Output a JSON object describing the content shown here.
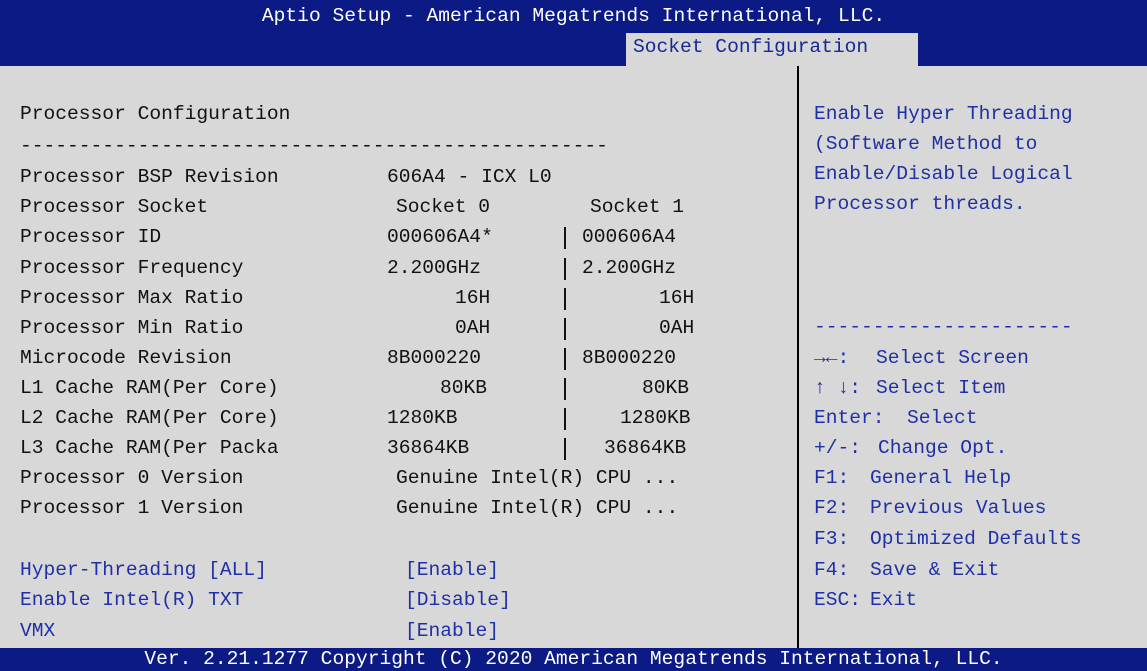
{
  "app": {
    "title": "Aptio Setup - American Megatrends International, LLC.",
    "active_tab": "Socket Configuration",
    "footer": "Ver. 2.21.1277 Copyright (C) 2020 American Megatrends International, LLC."
  },
  "section": {
    "heading": "Processor Configuration",
    "separator": "--------------------------------------------------"
  },
  "info_rows": [
    {
      "label": "Processor BSP Revision",
      "s0": "606A4 - ICX L0",
      "s1": ""
    },
    {
      "label": "Processor Socket",
      "s0": "Socket 0",
      "s1": "Socket 1"
    },
    {
      "label": "Processor ID",
      "s0": "000606A4*",
      "s1": "000606A4"
    },
    {
      "label": "Processor Frequency",
      "s0": "2.200GHz",
      "s1": "2.200GHz"
    },
    {
      "label": "Processor Max Ratio",
      "s0": "16H",
      "s1": "16H"
    },
    {
      "label": "Processor Min Ratio",
      "s0": "0AH",
      "s1": "0AH"
    },
    {
      "label": "Microcode Revision",
      "s0": "8B000220",
      "s1": "8B000220"
    },
    {
      "label": "L1 Cache RAM(Per Core)",
      "s0": "80KB",
      "s1": "80KB"
    },
    {
      "label": "L2 Cache RAM(Per Core)",
      "s0": "1280KB",
      "s1": "1280KB"
    },
    {
      "label": "L3 Cache RAM(Per Packa",
      "s0": "36864KB",
      "s1": "36864KB"
    },
    {
      "label": "Processor 0 Version",
      "s0": "Genuine Intel(R) CPU ...",
      "s1": ""
    },
    {
      "label": "Processor 1 Version",
      "s0": "Genuine Intel(R) CPU ...",
      "s1": ""
    }
  ],
  "options": [
    {
      "label": "Hyper-Threading [ALL]",
      "value": "[Enable]"
    },
    {
      "label": "Enable Intel(R) TXT",
      "value": "[Disable]"
    },
    {
      "label": "VMX",
      "value": "[Enable]"
    }
  ],
  "help": {
    "lines": [
      "Enable Hyper Threading",
      "(Software Method to",
      "Enable/Disable Logical",
      "Processor threads."
    ],
    "separator": "----------------------"
  },
  "keys": [
    {
      "key": "→←:",
      "action": "Select Screen"
    },
    {
      "key": "↑ ↓:",
      "action": "Select Item"
    },
    {
      "key": "Enter:",
      "action": "Select"
    },
    {
      "key": "+/-:",
      "action": "Change Opt."
    },
    {
      "key": "F1:",
      "action": "General Help"
    },
    {
      "key": "F2:",
      "action": "Previous Values"
    },
    {
      "key": "F3:",
      "action": "Optimized Defaults"
    },
    {
      "key": "F4:",
      "action": "Save & Exit"
    },
    {
      "key": "ESC:",
      "action": "Exit"
    }
  ],
  "colors": {
    "header_bg": "#0b1a85",
    "panel_bg": "#d8d8d8",
    "text": "#111111",
    "selectable_text": "#1f2fa5"
  }
}
